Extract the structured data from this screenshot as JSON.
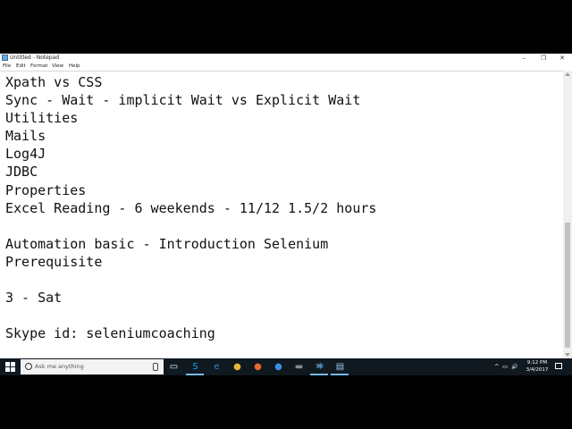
{
  "window": {
    "title": "Untitled - Notepad",
    "controls": {
      "minimize": "–",
      "maximize": "❐",
      "close": "✕"
    }
  },
  "menu": [
    "File",
    "Edit",
    "Format",
    "View",
    "Help"
  ],
  "editor": {
    "lines": [
      "Xpath vs CSS",
      "Sync - Wait - implicit Wait vs Explicit Wait",
      "Utilities",
      "Mails",
      "Log4J",
      "JDBC",
      "Properties",
      "Excel Reading - 6 weekends - 11/12 1.5/2 hours",
      "",
      "Automation basic - Introduction Selenium",
      "Prerequisite",
      "",
      "3 - Sat",
      "",
      "Skype id: seleniumcoaching"
    ]
  },
  "taskbar": {
    "search_placeholder": "Ask me anything",
    "icons": [
      {
        "name": "task-view-icon",
        "glyph": "▭",
        "color": ""
      },
      {
        "name": "skype-icon",
        "glyph": "S",
        "color": "#00aff0"
      },
      {
        "name": "edge-icon",
        "glyph": "e",
        "color": "#2f7fd6"
      },
      {
        "name": "chrome-icon",
        "glyph": "●",
        "color": "#e8b53a"
      },
      {
        "name": "firefox-icon",
        "glyph": "●",
        "color": "#e5692a"
      },
      {
        "name": "chrome-alt-icon",
        "glyph": "●",
        "color": "#3d8ee0"
      },
      {
        "name": "media-icon",
        "glyph": "▬",
        "color": "#888888"
      },
      {
        "name": "snipping-icon",
        "glyph": "✂",
        "color": "#aaaaaa"
      },
      {
        "name": "app-snowflake-icon",
        "glyph": "❄",
        "color": "#4aa3df"
      },
      {
        "name": "notepad-icon",
        "glyph": "▤",
        "color": "#9fc5e8"
      }
    ],
    "tray": {
      "up_arrow": "^",
      "network": "▭",
      "volume": "🔊"
    },
    "clock": {
      "time": "9:12 PM",
      "date": "3/4/2017"
    }
  }
}
